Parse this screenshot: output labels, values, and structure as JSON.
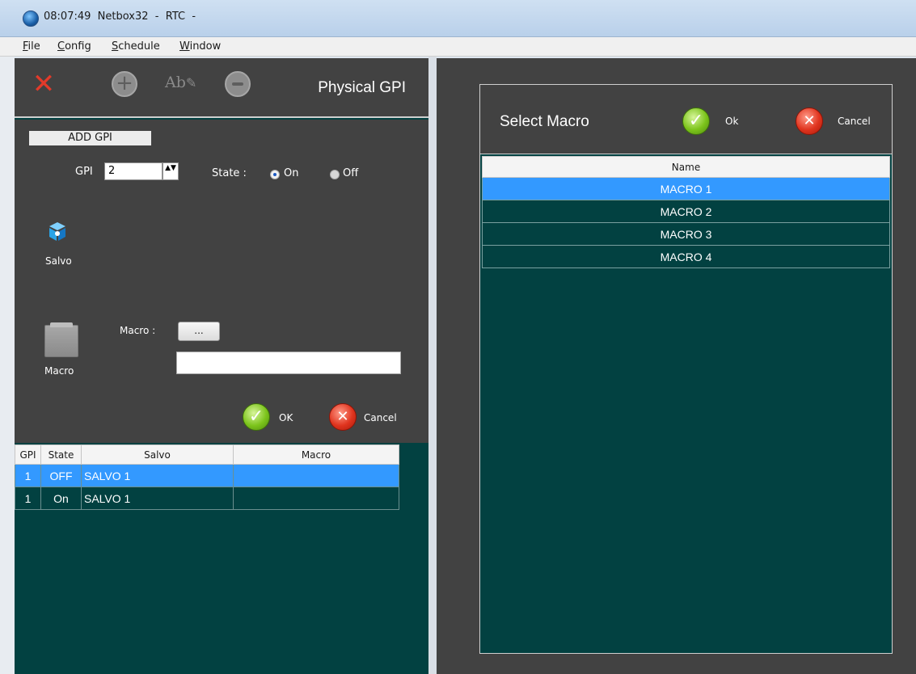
{
  "window": {
    "time": "08:07:49",
    "title": "Netbox32  -  RTC  -"
  },
  "menu": [
    {
      "acc": "F",
      "rest": "ile"
    },
    {
      "acc": "C",
      "rest": "onfig"
    },
    {
      "acc": "S",
      "rest": "chedule"
    },
    {
      "acc": "W",
      "rest": "indow"
    }
  ],
  "toolbar": {
    "pane_title": "Physical GPI",
    "delete_glyph": "✕",
    "add_glyph": "+",
    "rename_glyph": "Ab"
  },
  "form": {
    "section_label": "ADD GPI",
    "gpi_label": "GPI",
    "gpi_value": "2",
    "spinner_glyph": "▲▼",
    "state_label": "State :",
    "state_on": "On",
    "state_off": "Off",
    "state_selected": "On",
    "salvo_label": "Salvo",
    "macro_label": "Macro :",
    "macro_browse": "...",
    "macro_value": "",
    "macro_icon_label": "Macro",
    "ok_label": "OK",
    "cancel_label": "Cancel"
  },
  "gpi_table": {
    "columns": [
      "GPI",
      "State",
      "Salvo",
      "Macro"
    ],
    "rows": [
      {
        "gpi": "1",
        "state": "OFF",
        "salvo": "SALVO 1",
        "macro": "",
        "selected": true
      },
      {
        "gpi": "1",
        "state": "On",
        "salvo": "SALVO 1",
        "macro": "",
        "selected": false
      }
    ]
  },
  "macro_dialog": {
    "title": "Select Macro",
    "ok_label": "Ok",
    "cancel_label": "Cancel",
    "column": "Name",
    "items": [
      {
        "name": "MACRO 1",
        "selected": true
      },
      {
        "name": "MACRO 2",
        "selected": false
      },
      {
        "name": "MACRO 3",
        "selected": false
      },
      {
        "name": "MACRO 4",
        "selected": false
      }
    ]
  },
  "colors": {
    "panel_dark": "#424242",
    "list_teal": "#024141",
    "selection_blue": "#3399ff",
    "delete_red": "#e23a2a"
  }
}
